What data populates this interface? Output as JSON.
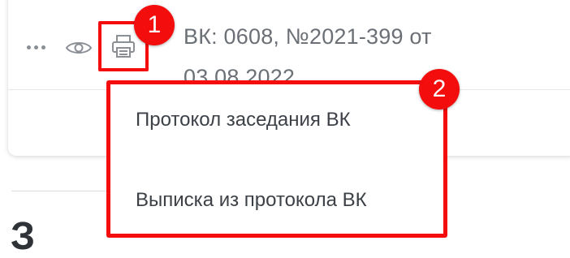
{
  "toolbar": {
    "more_icon": "more-horizontal-icon",
    "view_icon": "eye-icon",
    "print_icon": "printer-icon"
  },
  "record": {
    "title": "ВК: 0608, №2021-399 от 03.08.2022"
  },
  "callouts": {
    "print_button_number": "1",
    "menu_number": "2",
    "color": "#f40d0d"
  },
  "print_menu": {
    "items": [
      {
        "label": "Протокол заседания ВК"
      },
      {
        "label": "Выписка из протокола ВК"
      }
    ]
  },
  "section": {
    "heading_fragment": "З"
  },
  "colors": {
    "text_muted": "#6b7076",
    "text_primary": "#3c4147",
    "icon_gray": "#8a8f96",
    "highlight_red": "#f40d0d"
  }
}
